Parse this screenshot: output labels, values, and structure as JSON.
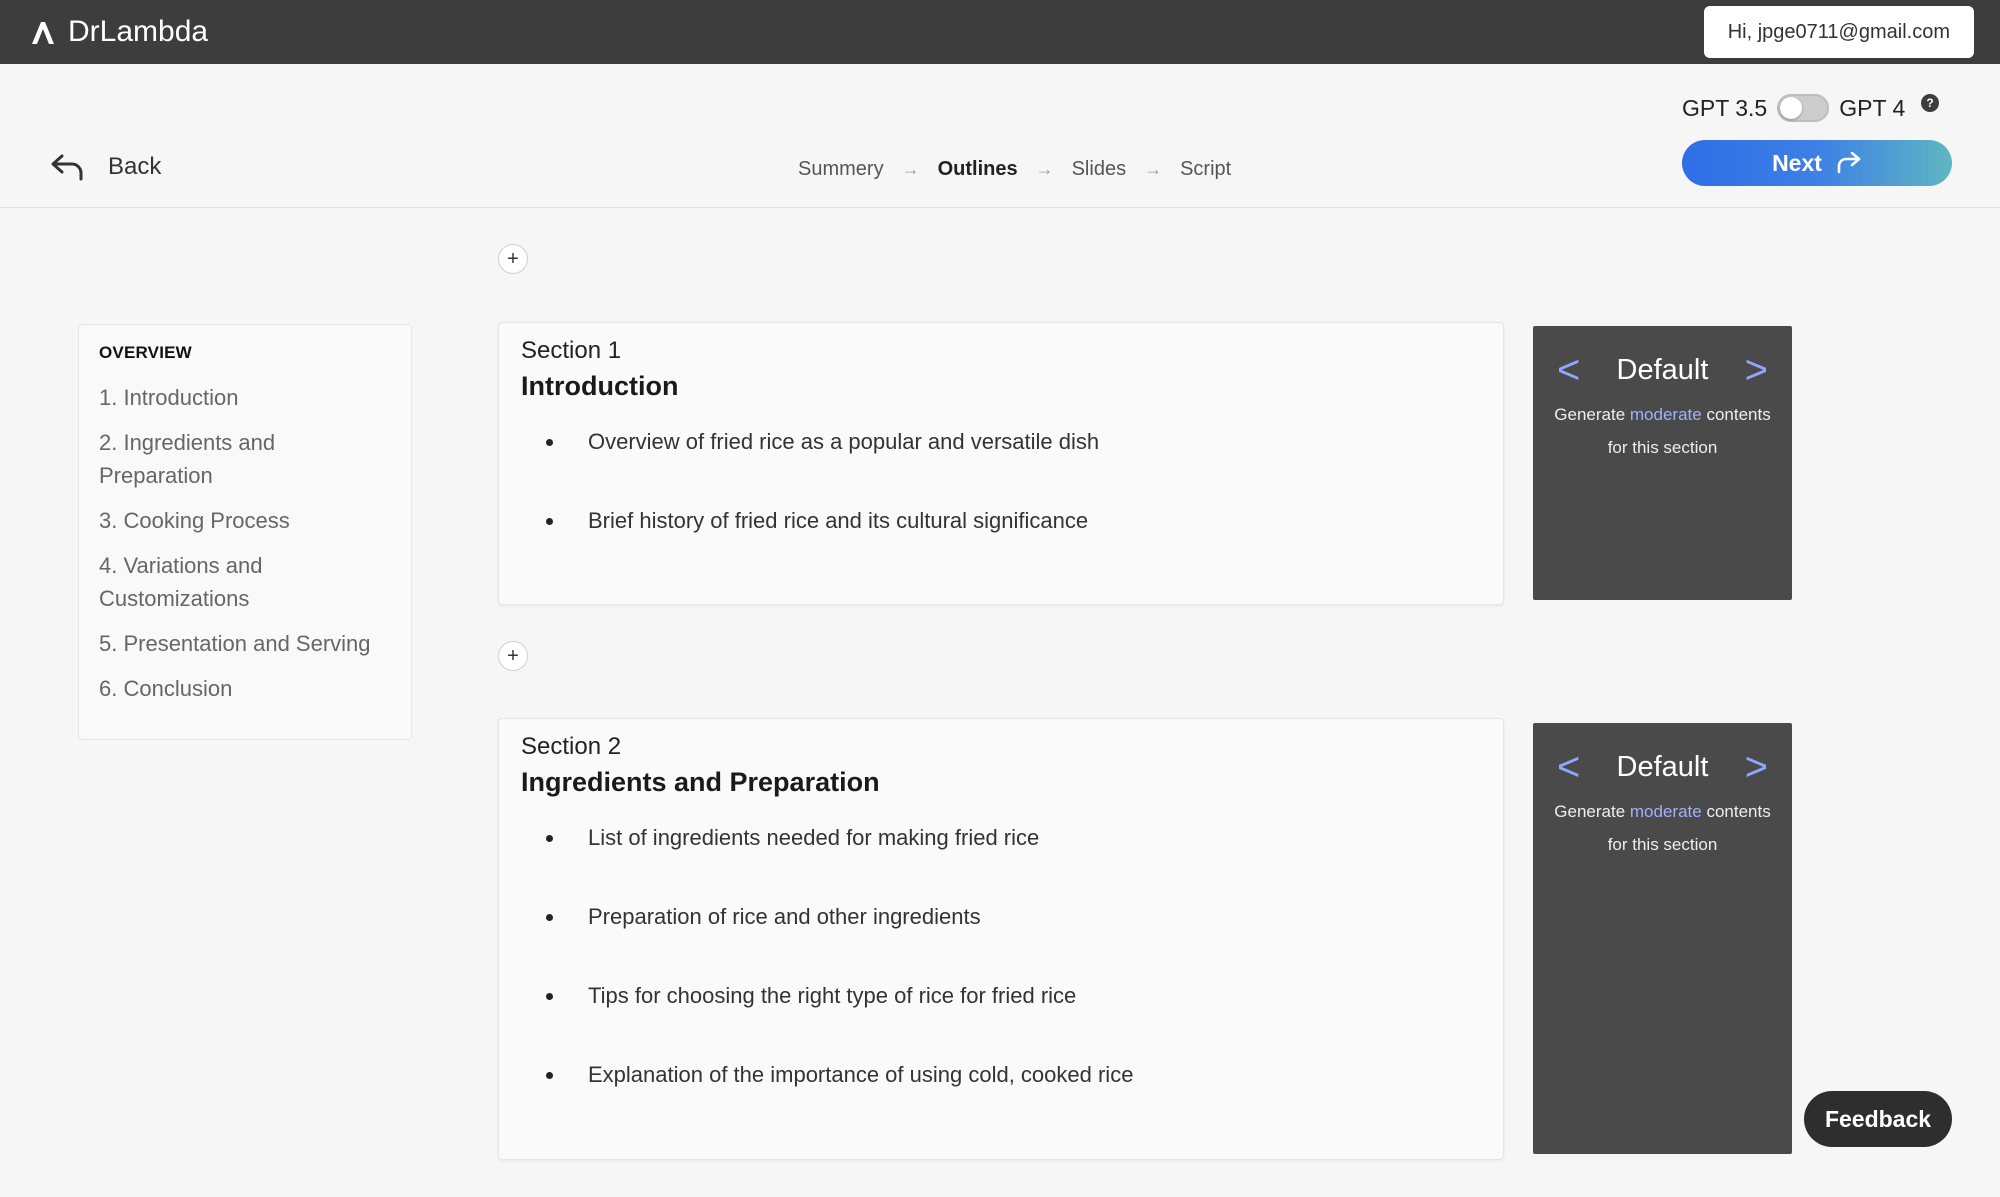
{
  "app": {
    "brand_name": "DrLambda",
    "user_greeting": "Hi, jpge0711@gmail.com"
  },
  "header": {
    "back_label": "Back",
    "steps": [
      "Summery",
      "Outlines",
      "Slides",
      "Script"
    ],
    "active_step": "Outlines",
    "model_left": "GPT 3.5",
    "model_right": "GPT 4",
    "help_glyph": "?",
    "next_label": "Next"
  },
  "overview": {
    "heading": "OVERVIEW",
    "items": [
      "1. Introduction",
      "2. Ingredients and Preparation",
      "3. Cooking Process",
      "4. Variations and Customizations",
      "5. Presentation and Serving",
      "6. Conclusion"
    ]
  },
  "sections": [
    {
      "number_label": "Section 1",
      "title": "Introduction",
      "bullets": [
        "Overview of fried rice as a popular and versatile dish",
        "Brief history of fried rice and its cultural significance"
      ],
      "panel": {
        "mode": "Default",
        "desc_prefix": "Generate ",
        "desc_highlight": "moderate",
        "desc_suffix": " contents for this section"
      }
    },
    {
      "number_label": "Section 2",
      "title": "Ingredients and Preparation",
      "bullets": [
        "List of ingredients needed for making fried rice",
        "Preparation of rice and other ingredients",
        "Tips for choosing the right type of rice for fried rice",
        "Explanation of the importance of using cold, cooked rice"
      ],
      "panel": {
        "mode": "Default",
        "desc_prefix": "Generate ",
        "desc_highlight": "moderate",
        "desc_suffix": " contents for this section"
      }
    }
  ],
  "add_button_glyph": "+",
  "panel_prev_glyph": "<",
  "panel_next_glyph": ">",
  "feedback_label": "Feedback",
  "colors": {
    "topbar": "#3d3d3d",
    "panel": "#4a4a4a",
    "accent_highlight": "#9fb0ff",
    "next_gradient_start": "#2f6ee6",
    "next_gradient_end": "#5fb6c2"
  }
}
